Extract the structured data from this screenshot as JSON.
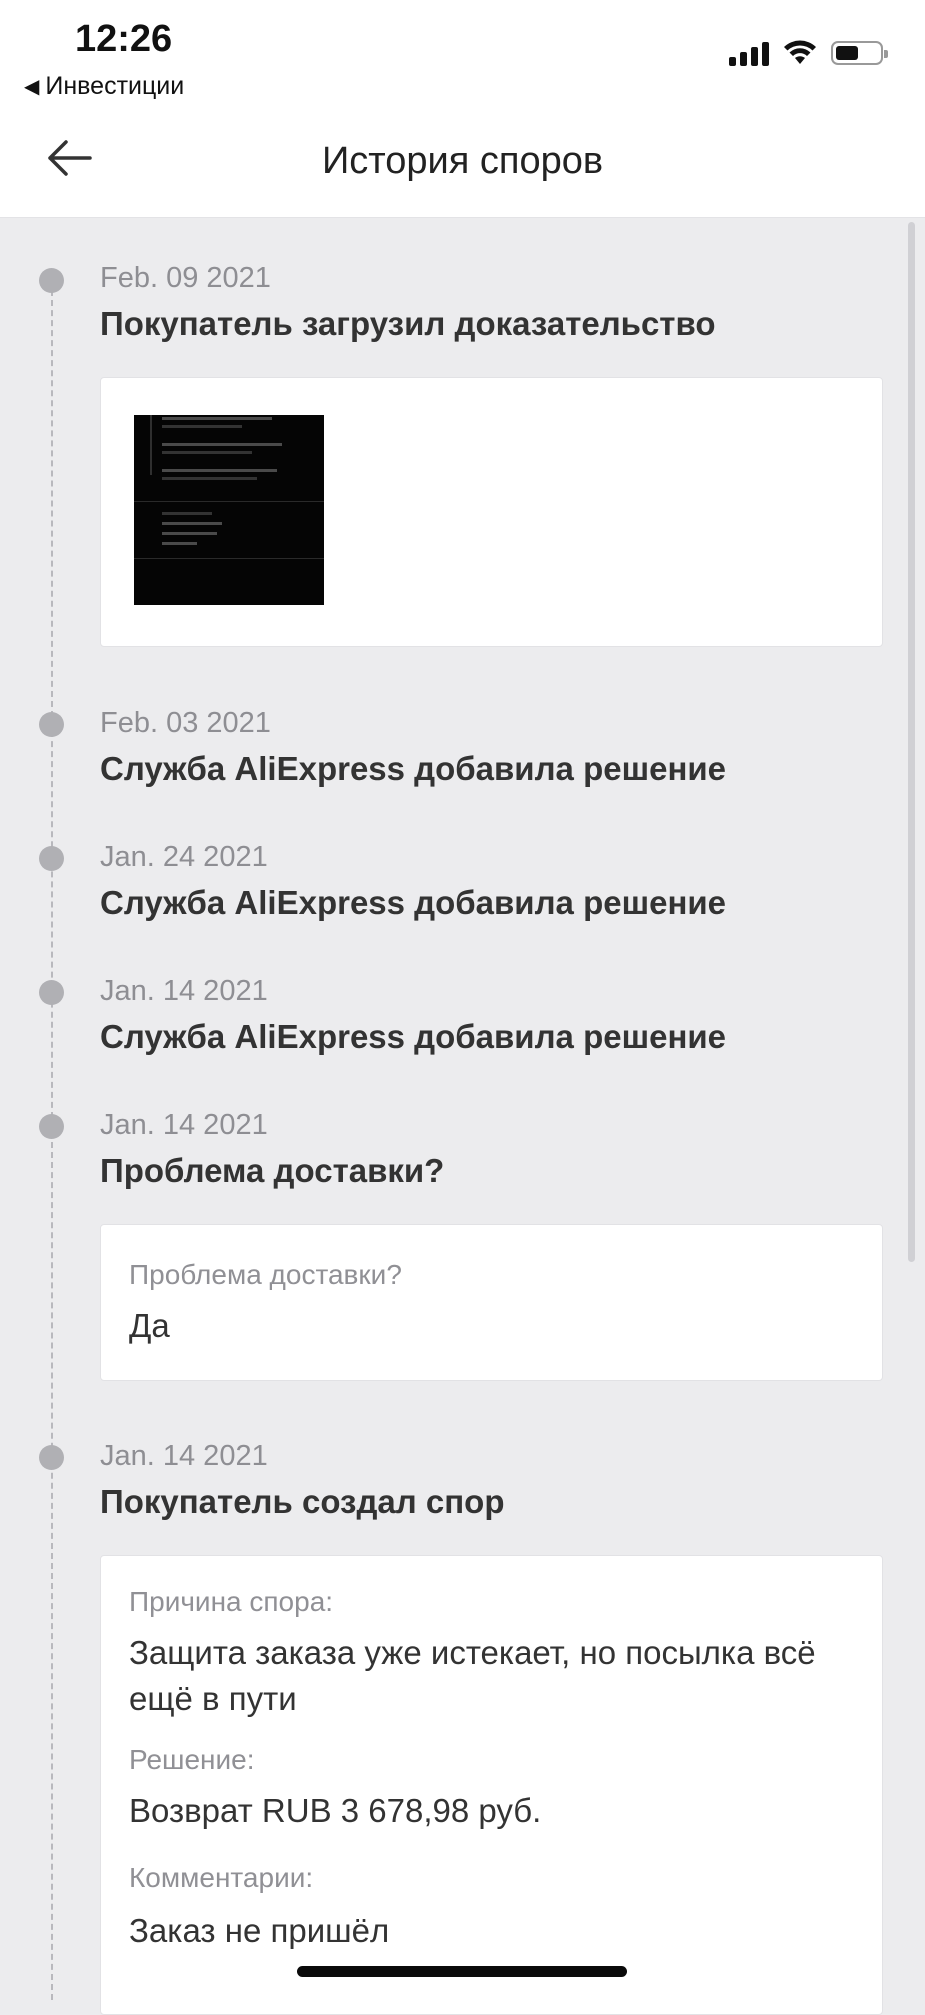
{
  "status_bar": {
    "time": "12:26",
    "back_app": "Инвестиции",
    "icons": [
      "cellular-signal-icon",
      "wifi-icon",
      "battery-icon"
    ]
  },
  "nav": {
    "title": "История споров",
    "back_icon": "arrow-left-icon"
  },
  "events": [
    {
      "date": "Feb. 09 2021",
      "title": "Покупатель загрузил доказательство"
    },
    {
      "date": "Feb. 03 2021",
      "title": "Служба AliExpress добавила решение"
    },
    {
      "date": "Jan. 24 2021",
      "title": "Служба AliExpress добавила решение"
    },
    {
      "date": "Jan. 14 2021",
      "title": "Служба AliExpress добавила решение"
    },
    {
      "date": "Jan. 14 2021",
      "title": "Проблема доставки?"
    },
    {
      "date": "Jan. 14 2021",
      "title": "Покупатель создал спор"
    }
  ],
  "delivery_card": {
    "label": "Проблема доставки?",
    "value": "Да"
  },
  "dispute_card": {
    "reason_label": "Причина спора:",
    "reason_value": "Защита заказа уже истекает, но посылка всё ещё в пути",
    "solution_label": "Решение:",
    "solution_value": "Возврат RUB 3 678,98 руб.",
    "comments_label": "Комментарии:",
    "comments_value": "Заказ не пришёл"
  },
  "colors": {
    "background": "#ececee",
    "card": "#ffffff",
    "timeline_dot": "#b0b0b4",
    "date_text": "#8e8e93"
  }
}
